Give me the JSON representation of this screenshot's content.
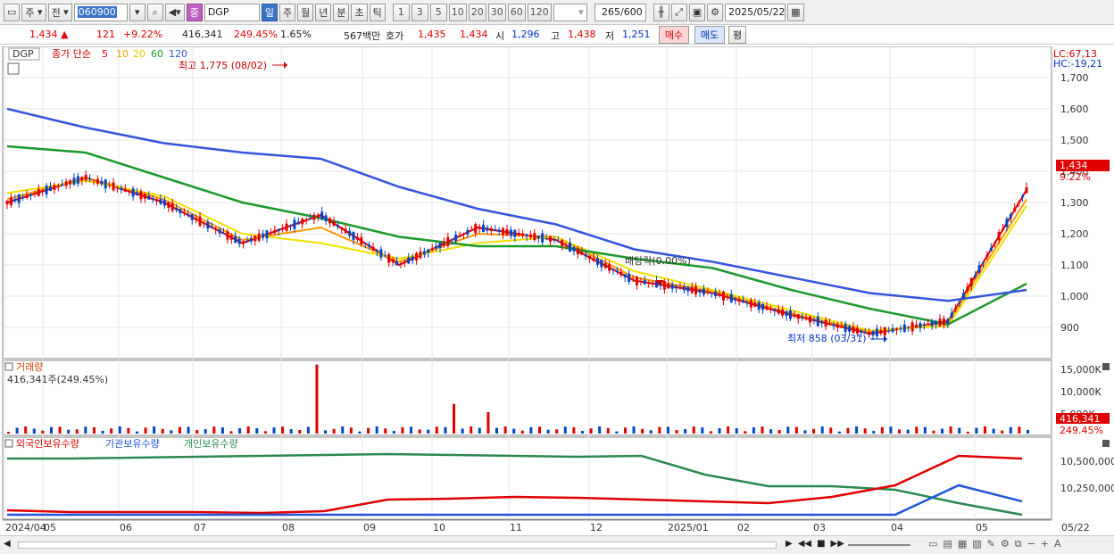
{
  "toolbar": {
    "type_label": "주",
    "prev_label": "전",
    "code": "060900",
    "name_badge": "중",
    "name": "DGP",
    "periods": [
      "일",
      "주",
      "월",
      "년",
      "분",
      "초",
      "틱"
    ],
    "active_period": "일",
    "ticks": [
      "1",
      "3",
      "5",
      "10",
      "20",
      "30",
      "60",
      "120"
    ],
    "count": "265",
    "count_max": "/600",
    "date": "2025/05/22"
  },
  "quote": {
    "price": "1,434",
    "change_arrow": "▲",
    "change": "121",
    "change_pct": "+9.22%",
    "volume": "416,341",
    "volume_ratio": "249.45%",
    "turnover": "1.65%",
    "amount": "567백만",
    "ask_label": "호가",
    "ask": "1,435",
    "bid": "1,434",
    "open_label": "시",
    "open": "1,296",
    "high_label": "고",
    "high": "1,438",
    "low_label": "저",
    "low": "1,251",
    "buy_label": "매수",
    "sell_label": "매도",
    "eval_label": "평"
  },
  "price_panel": {
    "symbol": "DGP",
    "ma_title": "종가 단순",
    "ma_periods": [
      "5",
      "10",
      "20",
      "60",
      "120"
    ],
    "lc": "LC:67,13",
    "hc": "HC:-19,21",
    "high_note": "최고 1,775 (08/02)",
    "low_note": "최저 858 (03/31)",
    "event_note": "배당락(0.00%)",
    "last_price": "1,434",
    "last_pct": "9.22%",
    "axis": [
      "1,700",
      "1,600",
      "1,500",
      "1,400",
      "1,300",
      "1,200",
      "1,100",
      "1,000",
      "900"
    ]
  },
  "volume_panel": {
    "title": "거래량",
    "value": "416,341주(249.45%)",
    "axis": [
      "15,000K",
      "10,000K",
      "5,000K"
    ],
    "last": "416,341",
    "last_pct": "249.45%"
  },
  "holdings_panel": {
    "legend": [
      "외국인보유수량",
      "기관보유수량",
      "개인보유수량"
    ],
    "axis": [
      "10,500,000",
      "10,250,000"
    ]
  },
  "x_axis": [
    "2024/04",
    "05",
    "06",
    "07",
    "08",
    "09",
    "10",
    "11",
    "12",
    "2025/01",
    "02",
    "03",
    "04",
    "05",
    "05/22"
  ],
  "colors": {
    "ma5": "#e00000",
    "ma10": "#ff9900",
    "ma20": "#f0e000",
    "ma60": "#1a9a2a",
    "ma120": "#3355dd",
    "foreign": "#e00000",
    "institution": "#2255dd",
    "individual": "#2a8a50"
  },
  "chart_data": {
    "type": "line",
    "title": "",
    "x": [
      "2024/04",
      "05",
      "06",
      "07",
      "08",
      "09",
      "10",
      "11",
      "12",
      "2025/01",
      "02",
      "03",
      "04",
      "05"
    ],
    "series": [
      {
        "name": "5",
        "values": [
          1300,
          1380,
          1300,
          1170,
          1260,
          1100,
          1220,
          1180,
          1050,
          1010,
          940,
          880,
          920,
          1340
        ]
      },
      {
        "name": "10",
        "values": [
          1310,
          1380,
          1310,
          1180,
          1220,
          1110,
          1200,
          1190,
          1060,
          1015,
          945,
          885,
          915,
          1310
        ]
      },
      {
        "name": "20",
        "values": [
          1330,
          1370,
          1320,
          1200,
          1170,
          1120,
          1170,
          1190,
          1080,
          1020,
          955,
          890,
          905,
          1290
        ]
      },
      {
        "name": "60",
        "values": [
          1480,
          1460,
          1380,
          1300,
          1250,
          1190,
          1160,
          1160,
          1120,
          1090,
          1020,
          960,
          910,
          1040
        ]
      },
      {
        "name": "120",
        "values": [
          1600,
          1540,
          1490,
          1460,
          1440,
          1350,
          1280,
          1230,
          1150,
          1110,
          1060,
          1010,
          985,
          1020
        ]
      }
    ],
    "ylim": [
      800,
      1800
    ],
    "grid": true
  }
}
